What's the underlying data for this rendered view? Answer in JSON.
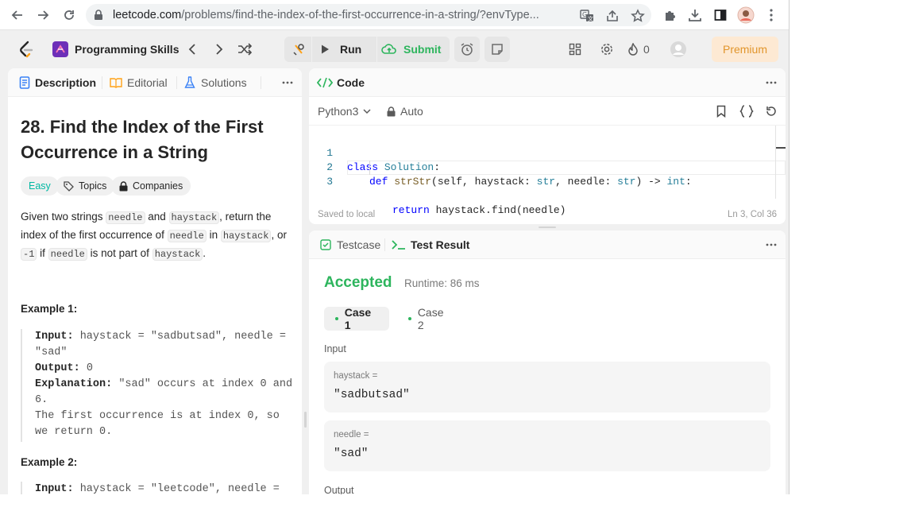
{
  "browser": {
    "url_host": "leetcode.com",
    "url_path": "/problems/find-the-index-of-the-first-occurrence-in-a-string/?envType...",
    "icons": [
      "back-arrow-icon",
      "forward-arrow-icon",
      "reload-icon",
      "lock-icon",
      "translate-icon",
      "share-icon",
      "star-icon",
      "extensions-icon",
      "download-icon",
      "sidepanel-icon",
      "profile-avatar-icon",
      "kebab-menu-icon"
    ]
  },
  "topbar": {
    "list_name": "Programming Skills",
    "run_label": "Run",
    "submit_label": "Submit",
    "streak_count": "0",
    "premium_label": "Premium"
  },
  "left_panel": {
    "tabs": [
      {
        "label": "Description"
      },
      {
        "label": "Editorial"
      },
      {
        "label": "Solutions"
      }
    ],
    "title": "28. Find the Index of the First Occurrence in a String",
    "difficulty": "Easy",
    "topics_label": "Topics",
    "companies_label": "Companies",
    "description": {
      "p1": "Given two strings ",
      "c1": "needle",
      "p2": " and ",
      "c2": "haystack",
      "p3": ", return the index of the first occurrence of ",
      "c3": "needle",
      "p4": " in ",
      "c4": "haystack",
      "p5": ", or ",
      "c5": "-1",
      "p6": " if ",
      "c6": "needle",
      "p7": " is not part of ",
      "c7": "haystack",
      "p8": "."
    },
    "example1": {
      "title": "Example 1:",
      "input_label": "Input:",
      "input_value": " haystack = \"sadbutsad\", needle = \"sad\"",
      "output_label": "Output:",
      "output_value": " 0",
      "explanation_label": "Explanation:",
      "explanation_value": " \"sad\" occurs at index 0 and 6.",
      "explanation_more": "The first occurrence is at index 0, so we return 0."
    },
    "example2": {
      "title": "Example 2:",
      "input_label": "Input:",
      "input_value": " haystack = \"leetcode\", needle ="
    }
  },
  "code_panel": {
    "title": "Code",
    "language": "Python3",
    "mode": "Auto",
    "lines": [
      {
        "num": "1"
      },
      {
        "num": "2"
      },
      {
        "num": "3"
      }
    ],
    "code": {
      "l1_kw": "class",
      "l1_name": "Solution",
      "l1_end": ":",
      "l2_kw": "def",
      "l2_fn": "strStr",
      "l2_a": "(self, haystack: ",
      "l2_t1": "str",
      "l2_b": ", needle: ",
      "l2_t2": "str",
      "l2_c": ") -> ",
      "l2_t3": "int",
      "l2_d": ":",
      "l3_kw": "return",
      "l3_rest": " haystack.find(needle)"
    },
    "saved_status": "Saved to local",
    "cursor_pos": "Ln 3, Col 36"
  },
  "result_panel": {
    "testcase_tab": "Testcase",
    "result_tab": "Test Result",
    "status": "Accepted",
    "runtime": "Runtime: 86 ms",
    "cases": [
      {
        "label": "Case 1"
      },
      {
        "label": "Case 2"
      }
    ],
    "input_heading": "Input",
    "params": [
      {
        "name": "haystack =",
        "value": "\"sadbutsad\""
      },
      {
        "name": "needle =",
        "value": "\"sad\""
      }
    ],
    "output_heading": "Output"
  },
  "colors": {
    "accepted_green": "#2db55d",
    "submit_green": "#2db55d",
    "easy_teal": "#00b8a3",
    "premium_orange": "#e1952b",
    "tab_blue": "#3b82f6"
  }
}
